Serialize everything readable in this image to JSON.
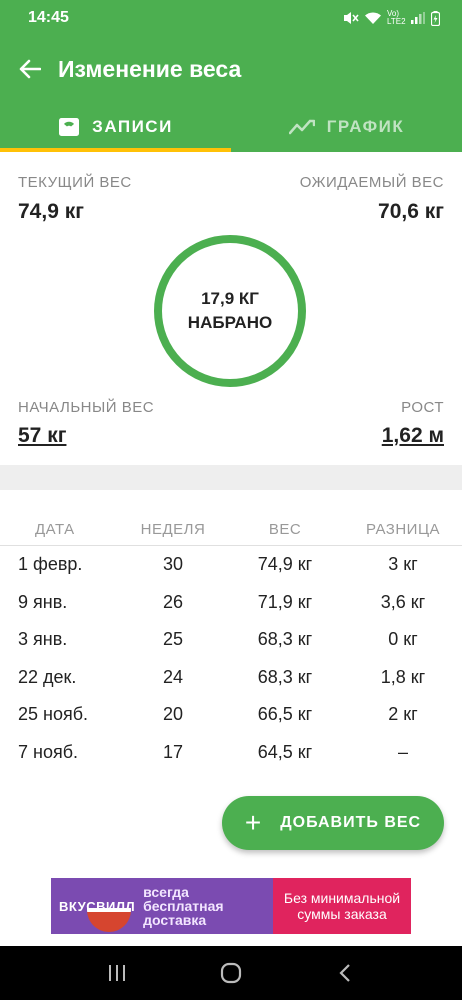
{
  "status": {
    "time": "14:45",
    "network_label": "Vo) LTE2"
  },
  "appbar": {
    "title": "Изменение веса"
  },
  "tabs": [
    {
      "label": "ЗАПИСИ",
      "icon": "scale-icon",
      "selected": true
    },
    {
      "label": "ГРАФИК",
      "icon": "trend-icon",
      "selected": false
    }
  ],
  "summary": {
    "current_label": "ТЕКУЩИЙ ВЕС",
    "current_value": "74,9 кг",
    "expected_label": "ОЖИДАЕМЫЙ ВЕС",
    "expected_value": "70,6 кг",
    "ring_value": "17,9 КГ",
    "ring_caption": "НАБРАНО",
    "start_label": "НАЧАЛЬНЫЙ ВЕС",
    "start_value": "57 кг",
    "height_label": "РОСТ",
    "height_value": "1,62 м"
  },
  "table": {
    "headers": [
      "ДАТА",
      "НЕДЕЛЯ",
      "ВЕС",
      "РАЗНИЦА"
    ],
    "rows": [
      [
        "1 февр.",
        "30",
        "74,9 кг",
        "3 кг"
      ],
      [
        "9 янв.",
        "26",
        "71,9 кг",
        "3,6 кг"
      ],
      [
        "3 янв.",
        "25",
        "68,3 кг",
        "0 кг"
      ],
      [
        "22 дек.",
        "24",
        "68,3 кг",
        "1,8 кг"
      ],
      [
        "25 нояб.",
        "20",
        "66,5 кг",
        "2 кг"
      ],
      [
        "7 нояб.",
        "17",
        "64,5 кг",
        "–"
      ]
    ]
  },
  "fab": {
    "label": "ДОБАВИТЬ ВЕС"
  },
  "ad": {
    "brand": "ВКУСВИЛЛ",
    "slogan_line1": "всегда",
    "slogan_line2": "бесплатная",
    "slogan_line3": "доставка",
    "offer": "Без минимальной суммы заказа"
  },
  "colors": {
    "primary": "#4caf50",
    "indicator": "#ffc107",
    "ad_purple": "#7b4bb1",
    "ad_pink": "#e0245e"
  }
}
